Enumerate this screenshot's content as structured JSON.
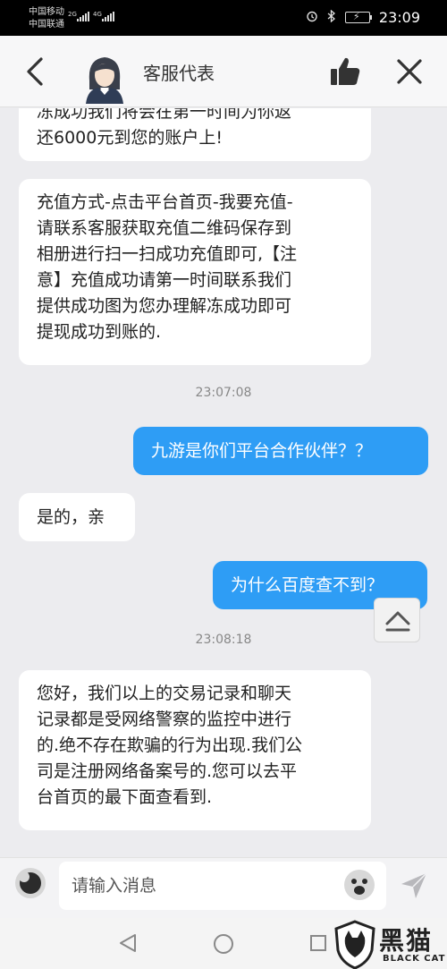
{
  "status_bar": {
    "carrier_1": "中国移动",
    "carrier_2": "中国联通",
    "net_1": "2G",
    "net_2": "4G",
    "time": "23:09",
    "icons": [
      "alarm-icon",
      "bluetooth-icon",
      "battery-icon"
    ]
  },
  "header": {
    "title": "客服代表",
    "icons": [
      "back-arrow-icon",
      "agent-avatar",
      "thumbs-up-icon",
      "close-icon"
    ]
  },
  "messages": [
    {
      "id": "m1",
      "side": "in",
      "lines": [
        "冻成功我们将会在第一时间为你返",
        "还6000元到您的账户上!"
      ]
    },
    {
      "id": "m2",
      "side": "in",
      "lines": [
        "充值方式-点击平台首页-我要充值-",
        "请联系客服获取充值二维码保存到",
        "相册进行扫一扫成功充值即可,【注",
        "意】充值成功请第一时间联系我们",
        "提供成功图为您办理解冻成功即可",
        "提现成功到账的."
      ]
    },
    {
      "id": "t1",
      "side": "time",
      "text": "23:07:08"
    },
    {
      "id": "m3",
      "side": "out",
      "text": "九游是你们平台合作伙伴？？"
    },
    {
      "id": "m4",
      "side": "in",
      "text": "是的，亲"
    },
    {
      "id": "m5",
      "side": "out",
      "text": "为什么百度查不到？"
    },
    {
      "id": "t2",
      "side": "time",
      "text": "23:08:18"
    },
    {
      "id": "m6",
      "side": "in",
      "lines": [
        "您好，我们以上的交易记录和聊天",
        "记录都是受网络警察的监控中进行",
        "的.绝不存在欺骗的行为出现.我们公",
        "司是注册网络备案号的.您可以去平",
        "台首页的最下面查看到."
      ]
    }
  ],
  "input_bar": {
    "placeholder": "请输入消息",
    "icons": [
      "voice-icon",
      "emoji-icon",
      "send-icon"
    ]
  },
  "nav_bar": {
    "icons": [
      "nav-back-icon",
      "nav-home-icon",
      "nav-recent-icon"
    ]
  },
  "watermark": {
    "cn": "黑猫",
    "en": "BLACK CAT"
  },
  "colors": {
    "outgoing_bubble": "#2e9df5",
    "incoming_bubble": "#ffffff",
    "background": "#ececef"
  }
}
